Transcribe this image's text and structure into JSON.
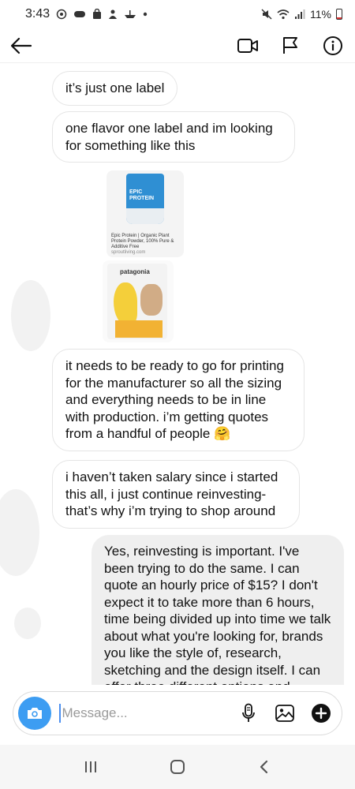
{
  "status_bar": {
    "time": "3:43",
    "battery": "11%",
    "icons": [
      "sync-icon",
      "game-icon",
      "bag-icon",
      "person-icon",
      "boat-icon",
      "dot-icon",
      "mute-icon",
      "wifi-icon",
      "signal-icon",
      "battery-icon"
    ]
  },
  "header": {
    "icons": [
      "back-arrow-icon",
      "video-call-icon",
      "flag-icon",
      "info-icon"
    ]
  },
  "messages": [
    {
      "direction": "incoming",
      "text": "it’s just one label"
    },
    {
      "direction": "incoming",
      "text": "one flavor one label and im looking for something like this"
    },
    {
      "direction": "incoming",
      "type": "media",
      "brand": "EPIC PROTEIN",
      "caption": "Epic Protein | Organic Plant Protein Powder, 100% Pure & Additive Free",
      "source": "sproutliving.com"
    },
    {
      "direction": "incoming",
      "type": "media",
      "brand": "patagonia"
    },
    {
      "direction": "incoming",
      "text": "it needs to be ready to go for printing for the manufacturer so all the sizing and everything needs to be in line with production. i’m getting quotes from a handful of people 🤗"
    },
    {
      "direction": "incoming",
      "text": "i haven’t taken salary since i started this all, i just continue reinvesting- that’s why i’m trying to shop around"
    },
    {
      "direction": "outgoing",
      "text": "Yes, reinvesting is important. I've been trying to do the same. I can quote an hourly price of $15? I don't expect it to take more than 6 hours, time being divided up into time we talk about what you're looking for, brands you like the style of, research, sketching and the design itself. I can offer three different options and"
    }
  ],
  "composer": {
    "placeholder": "Message...",
    "icons": [
      "camera-icon",
      "microphone-icon",
      "gallery-icon",
      "plus-icon"
    ]
  },
  "nav": {
    "icons": [
      "recents-icon",
      "home-icon",
      "back-icon"
    ]
  },
  "colors": {
    "camera_button": "#3d9df2",
    "outgoing_bubble": "#efefef",
    "incoming_border": "#e5e5e5"
  }
}
